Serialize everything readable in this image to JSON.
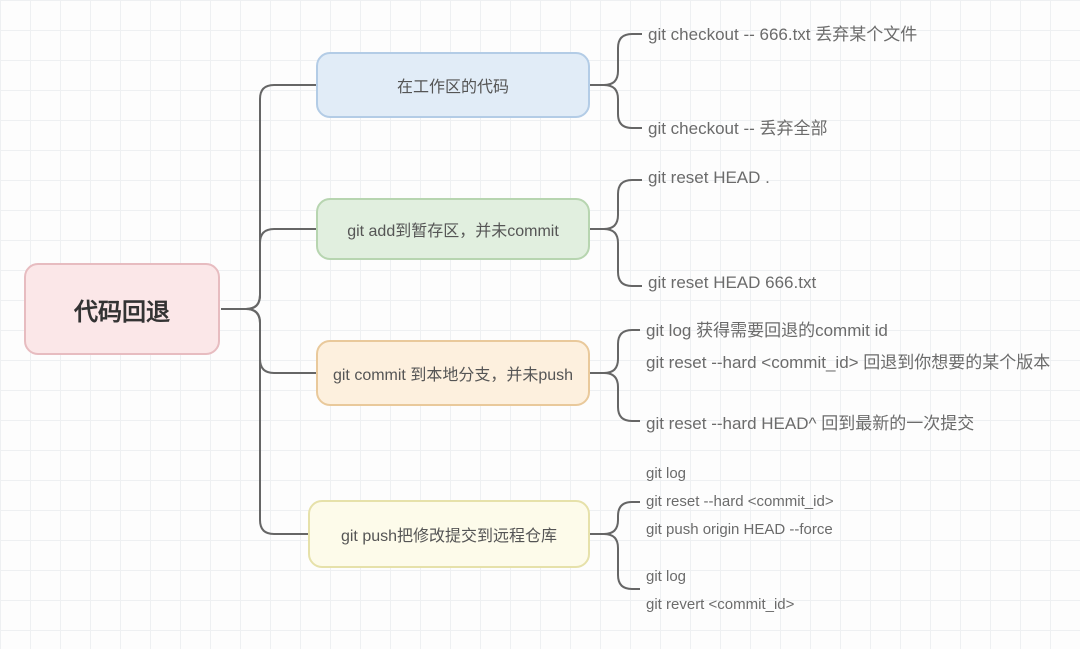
{
  "root": {
    "title": "代码回退"
  },
  "branches": {
    "workdir": {
      "label": "在工作区的代码",
      "leaves": [
        "git checkout -- 666.txt   丢弃某个文件",
        "git checkout -- 丢弃全部"
      ]
    },
    "staged": {
      "label": "git add到暂存区，并未commit",
      "leaves": [
        "git reset HEAD .",
        "git reset HEAD 666.txt"
      ]
    },
    "committed": {
      "label": "git commit 到本地分支，并未push",
      "leaves": [
        "git log 获得需要回退的commit id",
        "git reset --hard  <commit_id> 回退到你想要的某个版本",
        "git reset --hard HEAD^     回到最新的一次提交"
      ]
    },
    "pushed": {
      "label": "git push把修改提交到远程仓库",
      "leaves": [
        "git log",
        "git reset --hard  <commit_id>",
        "git push origin HEAD --force",
        "git log",
        "git revert <commit_id>"
      ]
    }
  }
}
